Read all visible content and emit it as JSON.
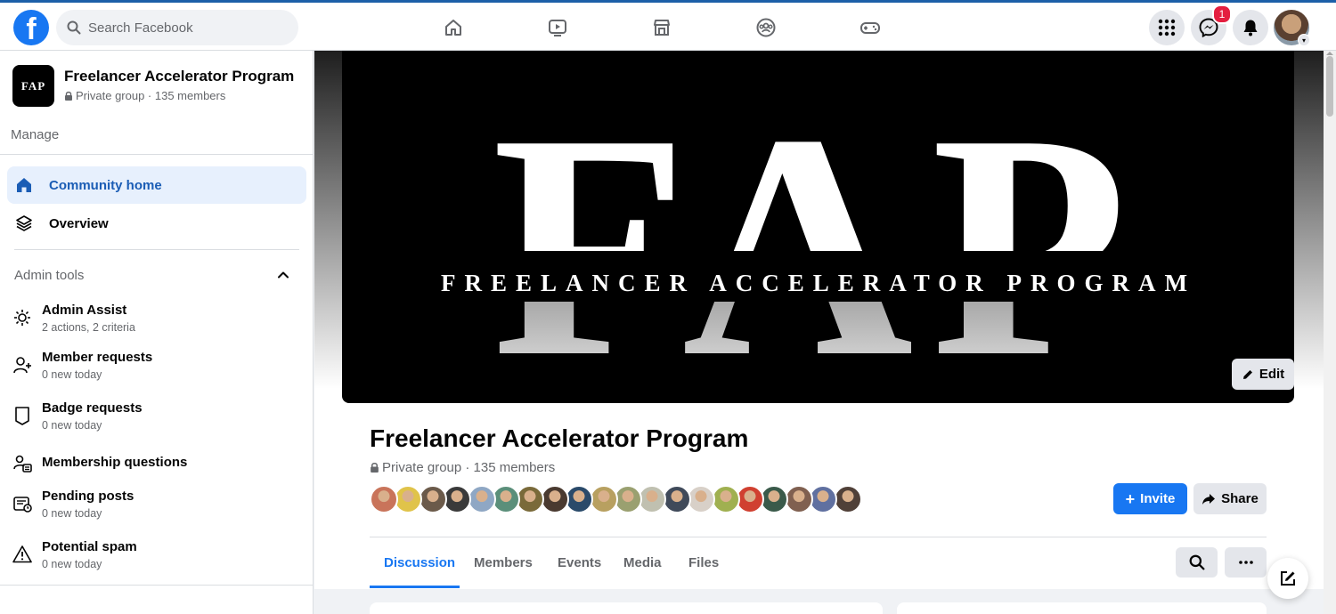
{
  "topbar": {
    "logo": "f",
    "search_placeholder": "Search Facebook",
    "nav_icons": [
      "home-icon",
      "watch-icon",
      "marketplace-icon",
      "groups-icon",
      "gaming-icon"
    ],
    "messenger_badge": "1"
  },
  "sidebar": {
    "group_thumb": "FAP",
    "group_name": "Freelancer Accelerator Program",
    "group_meta": "Private group · 135 members",
    "manage_label": "Manage",
    "nav": [
      {
        "label": "Community home",
        "icon": "home-icon",
        "active": true
      },
      {
        "label": "Overview",
        "icon": "layers-icon",
        "active": false
      }
    ],
    "admin_tools_label": "Admin tools",
    "tools": [
      {
        "title": "Admin Assist",
        "subtitle": "2 actions, 2 criteria",
        "icon": "admin-assist-icon"
      },
      {
        "title": "Member requests",
        "subtitle": "0 new today",
        "icon": "member-requests-icon"
      },
      {
        "title": "Badge requests",
        "subtitle": "0 new today",
        "icon": "badge-icon"
      },
      {
        "title": "Membership questions",
        "subtitle": "",
        "icon": "questions-icon"
      },
      {
        "title": "Pending posts",
        "subtitle": "0 new today",
        "icon": "pending-posts-icon"
      },
      {
        "title": "Potential spam",
        "subtitle": "0 new today",
        "icon": "warning-icon"
      }
    ]
  },
  "cover": {
    "big_letters": "FAP",
    "tagline": "FREELANCER ACCELERATOR PROGRAM",
    "edit_label": "Edit"
  },
  "group": {
    "title": "Freelancer Accelerator Program",
    "meta": "Private group · 135 members",
    "invite_label": "Invite",
    "share_label": "Share",
    "member_face_colors": [
      "#c9745a",
      "#e0c34a",
      "#6b5a4a",
      "#3a3a3a",
      "#8fa7c4",
      "#5b8f7a",
      "#7a6a3a",
      "#4a3a30",
      "#2a4a6a",
      "#b8a060",
      "#9aa070",
      "#c0c0b0",
      "#404a5a",
      "#d8d0c8",
      "#a0b050",
      "#d04030",
      "#3a5a4a",
      "#806050",
      "#6070a0",
      "#504038"
    ]
  },
  "tabs": [
    {
      "label": "Discussion",
      "active": true
    },
    {
      "label": "Members",
      "active": false
    },
    {
      "label": "Events",
      "active": false
    },
    {
      "label": "Media",
      "active": false
    },
    {
      "label": "Files",
      "active": false
    }
  ],
  "colors": {
    "brand": "#1877f2",
    "active_bg": "#e7f0fd",
    "badge": "#e41e3f"
  }
}
